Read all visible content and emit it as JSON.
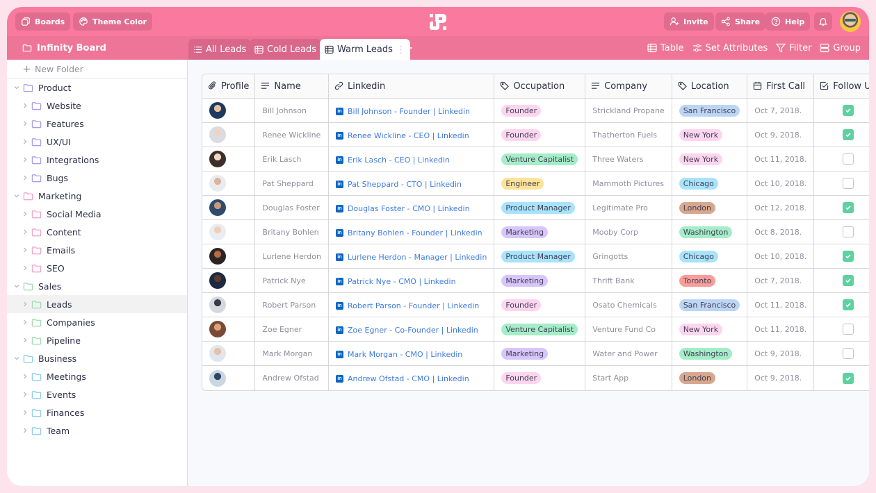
{
  "header": {
    "boards_label": "Boards",
    "theme_label": "Theme Color",
    "invite_label": "Invite",
    "share_label": "Share",
    "help_label": "Help"
  },
  "board": {
    "title": "Infinity Board"
  },
  "tabs": [
    {
      "label": "All Leads",
      "icon": "list-icon"
    },
    {
      "label": "Cold Leads",
      "icon": "table-icon"
    },
    {
      "label": "Warm Leads",
      "icon": "table-icon",
      "active": true
    }
  ],
  "toolbar": {
    "table_label": "Table",
    "attributes_label": "Set Attributes",
    "filter_label": "Filter",
    "group_label": "Group"
  },
  "sidebar": {
    "new_folder_label": "New Folder",
    "groups": [
      {
        "label": "Product",
        "color": "#a99cf0",
        "children": [
          "Website",
          "Features",
          "UX/UI",
          "Integrations",
          "Bugs"
        ]
      },
      {
        "label": "Marketing",
        "color": "#f6a3c8",
        "children": [
          "Social Media",
          "Content",
          "Emails",
          "SEO"
        ]
      },
      {
        "label": "Sales",
        "color": "#9fdcb2",
        "children": [
          "Leads",
          "Companies",
          "Pipeline"
        ]
      },
      {
        "label": "Business",
        "color": "#8ccdf2",
        "children": [
          "Meetings",
          "Events",
          "Finances",
          "Team"
        ]
      }
    ],
    "selected": "Leads"
  },
  "table": {
    "columns": [
      "Profile",
      "Name",
      "Linkedin",
      "Occupation",
      "Company",
      "Location",
      "First Call",
      "Follow Up"
    ],
    "rows": [
      {
        "name": "Bill Johnson",
        "linkedin": "Bill Johnson - Founder | Linkedin",
        "occupation": "Founder",
        "company": "Strickland Propane",
        "location": "San Francisco",
        "first_call": "Oct 7, 2018.",
        "follow_up": true
      },
      {
        "name": "Renee Wickline",
        "linkedin": "Renee Wickline - CEO | Linkedin",
        "occupation": "Founder",
        "company": "Thatherton Fuels",
        "location": "New York",
        "first_call": "Oct 9, 2018.",
        "follow_up": true
      },
      {
        "name": "Erik Lasch",
        "linkedin": "Erik Lasch - CEO | Linkedin",
        "occupation": "Venture Capitalist",
        "company": "Three Waters",
        "location": "New York",
        "first_call": "Oct 11, 2018.",
        "follow_up": false
      },
      {
        "name": "Pat Sheppard",
        "linkedin": "Pat Sheppard - CTO | Linkedin",
        "occupation": "Engineer",
        "company": "Mammoth Pictures",
        "location": "Chicago",
        "first_call": "Oct 10, 2018.",
        "follow_up": false
      },
      {
        "name": "Douglas Foster",
        "linkedin": "Douglas Foster - CMO | Linkedin",
        "occupation": "Product Manager",
        "company": "Legitimate Pro",
        "location": "London",
        "first_call": "Oct 12, 2018.",
        "follow_up": true
      },
      {
        "name": "Britany Bohlen",
        "linkedin": "Britany Bohlen - Founder | Linkedin",
        "occupation": "Marketing",
        "company": "Mooby Corp",
        "location": "Washington",
        "first_call": "Oct 8, 2018.",
        "follow_up": false
      },
      {
        "name": "Lurlene Herdon",
        "linkedin": "Lurlene Herdon - Manager | Linkedin",
        "occupation": "Product Manager",
        "company": "Gringotts",
        "location": "Chicago",
        "first_call": "Oct 10, 2018.",
        "follow_up": true
      },
      {
        "name": "Patrick Nye",
        "linkedin": "Patrick Nye - CMO | Linkedin",
        "occupation": "Marketing",
        "company": "Thrift Bank",
        "location": "Toronto",
        "first_call": "Oct 7, 2018.",
        "follow_up": true
      },
      {
        "name": "Robert Parson",
        "linkedin": "Robert Parson - Founder | Linkedin",
        "occupation": "Founder",
        "company": "Osato Chemicals",
        "location": "San Francisco",
        "first_call": "Oct 11, 2018.",
        "follow_up": true
      },
      {
        "name": "Zoe Egner",
        "linkedin": "Zoe Egner - Co-Founder | Linkedin",
        "occupation": "Venture Capitalist",
        "company": "Venture Fund Co",
        "location": "New York",
        "first_call": "Oct 11, 2018.",
        "follow_up": false
      },
      {
        "name": "Mark Morgan",
        "linkedin": "Mark Morgan - CMO | Linkedin",
        "occupation": "Marketing",
        "company": "Water and Power",
        "location": "Washington",
        "first_call": "Oct 9, 2018.",
        "follow_up": false
      },
      {
        "name": "Andrew Ofstad",
        "linkedin": "Andrew Ofstad - CMO | Linkedin",
        "occupation": "Founder",
        "company": "Start App",
        "location": "London",
        "first_call": "Oct 9, 2018.",
        "follow_up": true
      }
    ]
  },
  "tag_colors": {
    "Founder": "#fdd5ee",
    "Venture Capitalist": "#a5ecc8",
    "Engineer": "#fde39a",
    "Product Manager": "#a8e3fb",
    "Marketing": "#d8c6fb",
    "San Francisco": "#bdd5f5",
    "New York": "#fdd5ee",
    "Chicago": "#a8e3fb",
    "London": "#d8a88e",
    "Washington": "#a5ecc8",
    "Toronto": "#f99d9a"
  },
  "colors": {
    "header": "#f97a9e",
    "subbar": "#ee7597",
    "check_on": "#5fd1a0",
    "link": "#3f7be0"
  }
}
